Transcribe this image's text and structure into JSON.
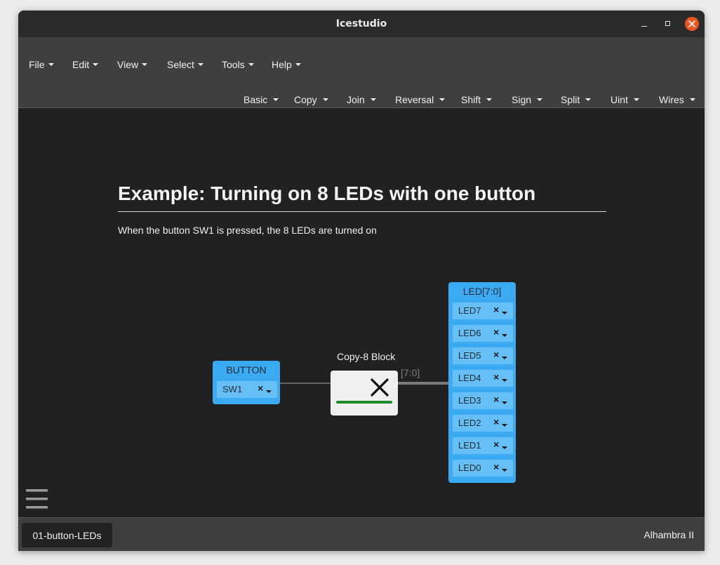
{
  "window": {
    "title": "Icestudio"
  },
  "menubar": {
    "items": [
      {
        "label": "File"
      },
      {
        "label": "Edit"
      },
      {
        "label": "View"
      },
      {
        "label": "Select"
      },
      {
        "label": "Tools"
      },
      {
        "label": "Help"
      }
    ]
  },
  "toolbar": {
    "items": [
      {
        "label": "Basic"
      },
      {
        "label": "Copy"
      },
      {
        "label": "Join"
      },
      {
        "label": "Reversal"
      },
      {
        "label": "Shift"
      },
      {
        "label": "Sign"
      },
      {
        "label": "Split"
      },
      {
        "label": "Uint"
      },
      {
        "label": "Wires"
      }
    ]
  },
  "canvas": {
    "heading": "Example: Turning on 8 LEDs with one button",
    "description": "When the button SW1 is pressed, the 8 LEDs are turned on",
    "button_block": {
      "title": "BUTTON",
      "pin": "SW1"
    },
    "copy_block": {
      "label": "Copy-8 Block"
    },
    "bus_label": "[7:0]",
    "led_block": {
      "title": "LED[7:0]",
      "pins": [
        "LED7",
        "LED6",
        "LED5",
        "LED4",
        "LED3",
        "LED2",
        "LED1",
        "LED0"
      ]
    },
    "pin_clear_glyph": "×"
  },
  "statusbar": {
    "file_tab": "01-button-LEDs",
    "board": "Alhambra II"
  },
  "colors": {
    "block_blue": "#3aabf2",
    "pin_field": "#66bff7",
    "canvas_bg": "#212121",
    "menubar_bg": "#3f3f3f",
    "close_button": "#e95420",
    "copy_bar": "#1e8c28"
  }
}
